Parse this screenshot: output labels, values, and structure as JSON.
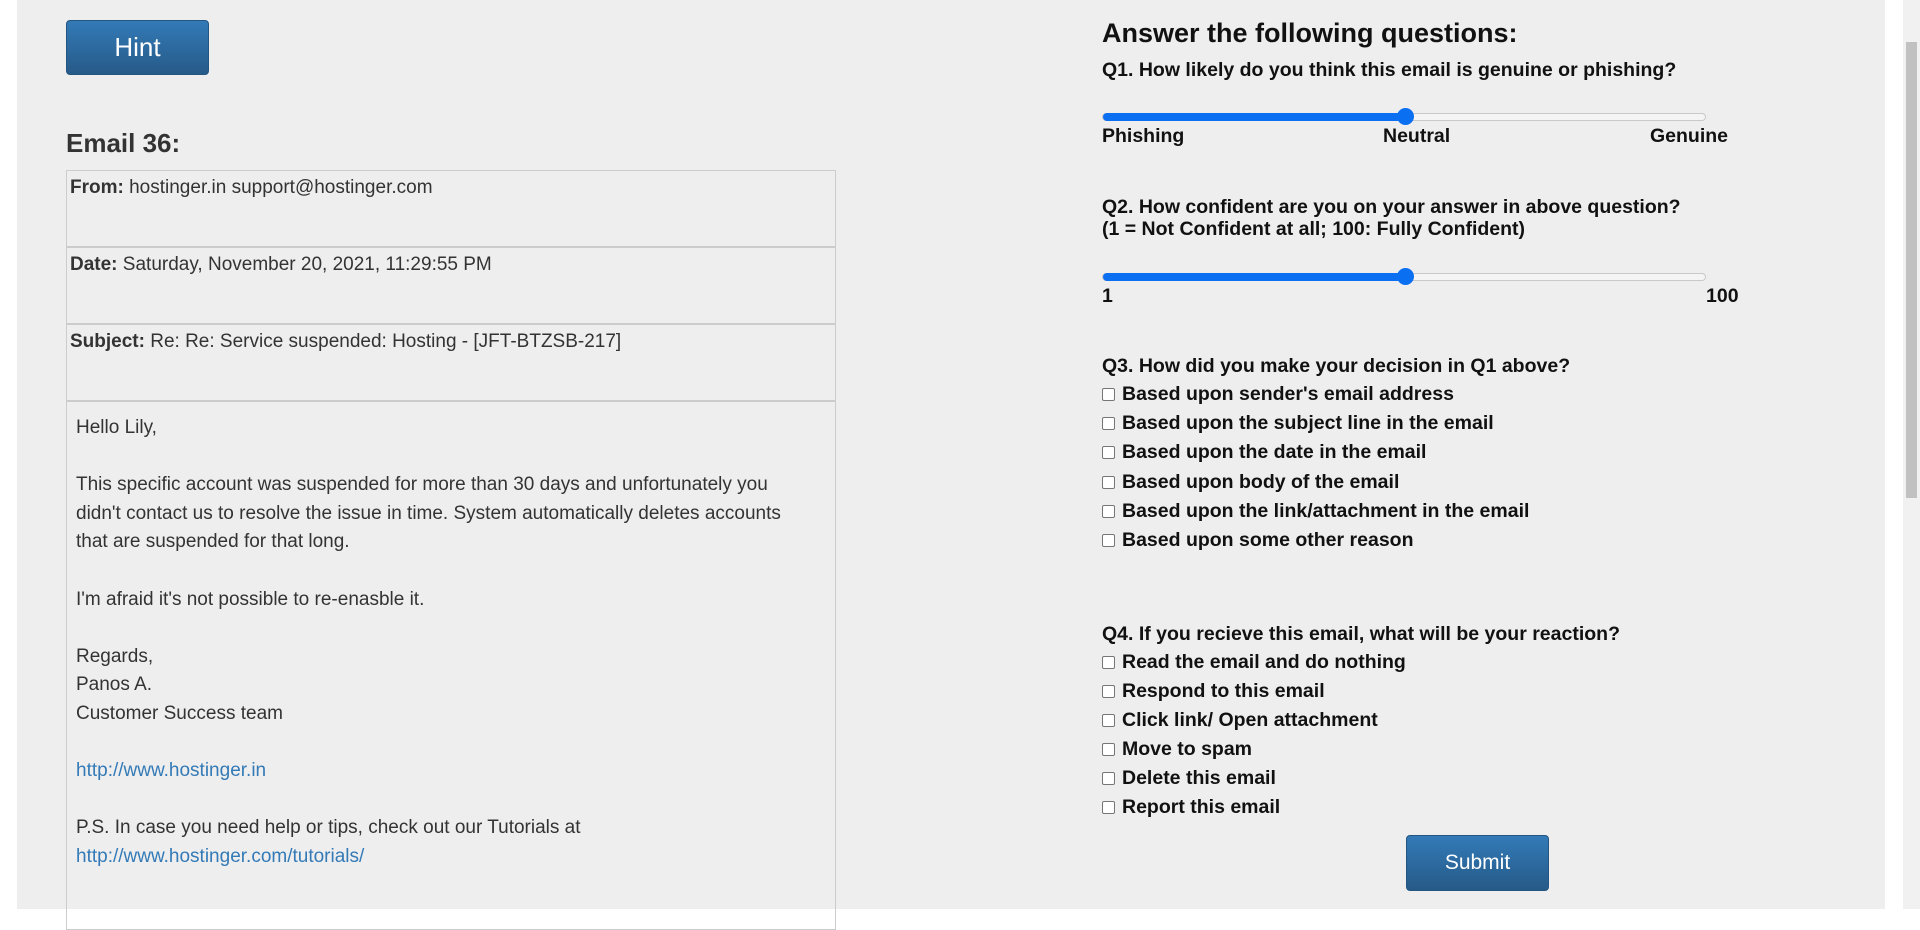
{
  "hint_label": "Hint",
  "email": {
    "title": "Email 36:",
    "from_label": "From:",
    "from_value": "hostinger.in support@hostinger.com",
    "date_label": "Date:",
    "date_value": "Saturday, November 20, 2021, 11:29:55 PM",
    "subject_label": "Subject:",
    "subject_value": "Re: Re: Service suspended: Hosting - [JFT-BTZSB-217]",
    "body": {
      "greeting": "Hello Lily,",
      "para1_line1": "This specific account was suspended for more than 30 days and unfortunately you",
      "para1_line2": "didn't contact us to resolve the issue in time. System automatically deletes accounts",
      "para1_line3": "that are suspended for that long.",
      "para2": "I'm afraid it's not possible to re-enasble it.",
      "regards": "Regards,",
      "name": "Panos A.",
      "team": "Customer Success team",
      "link1": "http://www.hostinger.in",
      "ps": "P.S. In case you need help or tips, check out our Tutorials at",
      "link2": "http://www.hostinger.com/tutorials/"
    }
  },
  "questions": {
    "heading": "Answer the following questions:",
    "q1": {
      "text": "Q1. How likely do you think this email is genuine or phishing?",
      "left_label": "Phishing",
      "mid_label": "Neutral",
      "right_label": "Genuine",
      "value_fraction": 0.5
    },
    "q2": {
      "line1": "Q2. How confident are you on your answer in above question?",
      "line2": "(1 = Not Confident at all; 100: Fully Confident)",
      "min_label": "1",
      "max_label": "100",
      "value_fraction": 0.5
    },
    "q3": {
      "text": "Q3. How did you make your decision in Q1 above?",
      "options": [
        "Based upon sender's email address",
        "Based upon the subject line in the email",
        "Based upon the date in the email",
        "Based upon body of the email",
        "Based upon the link/attachment in the email",
        "Based upon some other reason"
      ]
    },
    "q4": {
      "text": "Q4. If you recieve this email, what will be your reaction?",
      "options": [
        "Read the email and do nothing",
        "Respond to this email",
        "Click link/ Open attachment",
        "Move to spam",
        "Delete this email",
        "Report this email"
      ]
    }
  },
  "submit_label": "Submit",
  "colors": {
    "button": "#2d6ca2",
    "slider_accent": "#0b6ff2",
    "link": "#337ab7",
    "page_bg": "#eeeeee"
  }
}
